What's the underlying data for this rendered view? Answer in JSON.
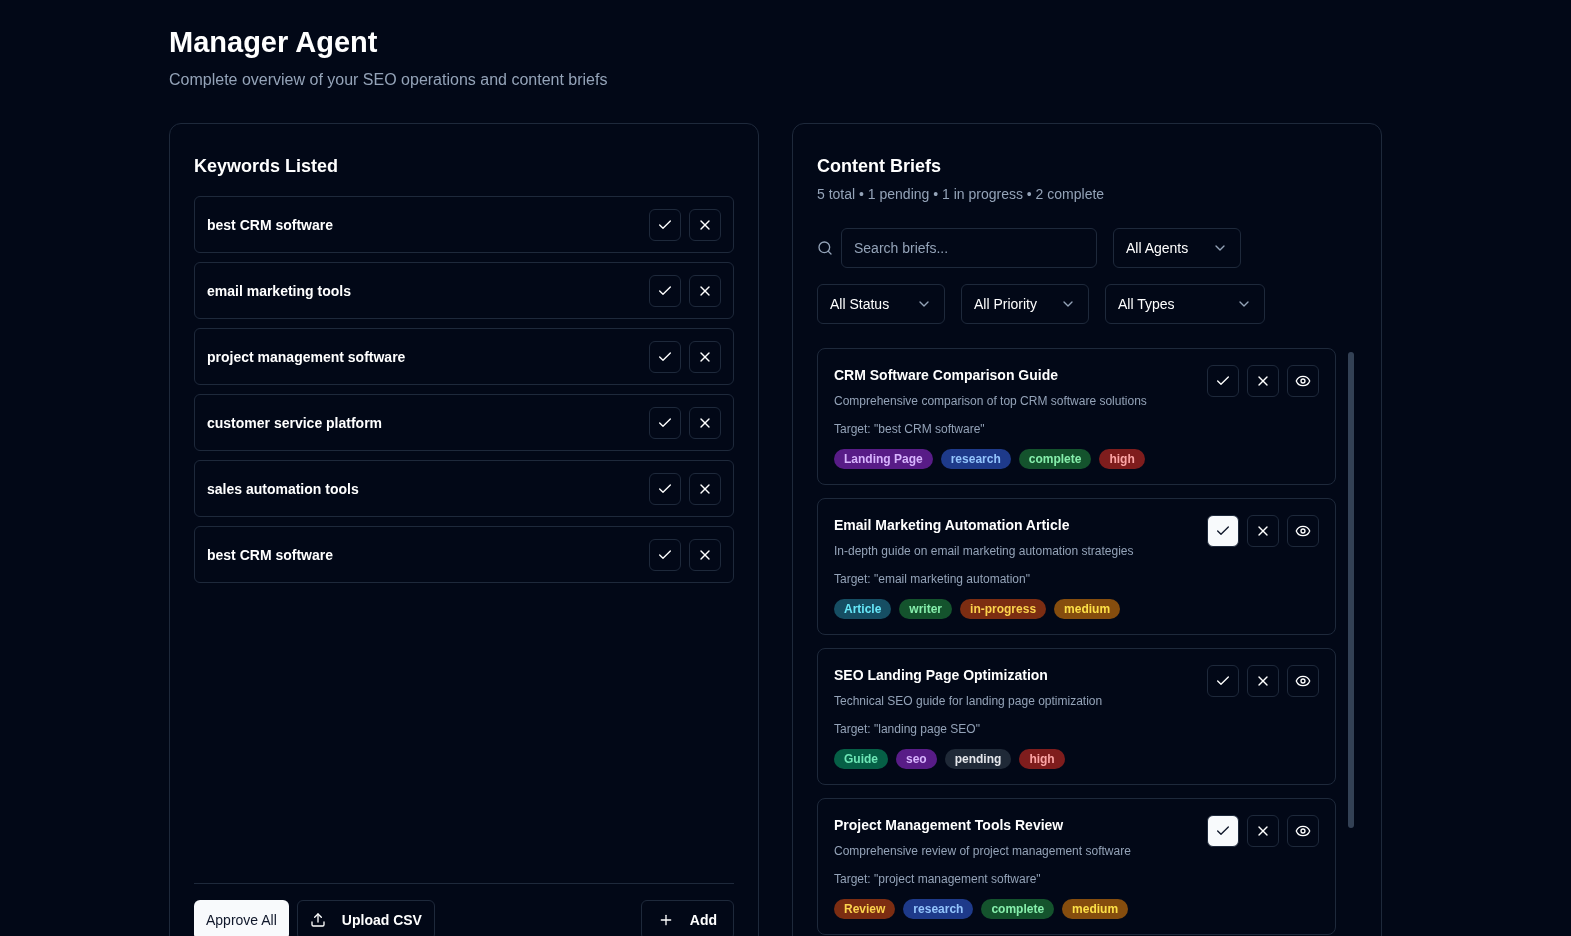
{
  "header": {
    "title": "Manager Agent",
    "subtitle": "Complete overview of your SEO operations and content briefs"
  },
  "keywords": {
    "title": "Keywords Listed",
    "items": [
      {
        "text": "best CRM software"
      },
      {
        "text": "email marketing tools"
      },
      {
        "text": "project management software"
      },
      {
        "text": "customer service platform"
      },
      {
        "text": "sales automation tools"
      },
      {
        "text": "best CRM software"
      }
    ],
    "actions": [
      "Approve All",
      "Upload CSV",
      "Add"
    ]
  },
  "briefs": {
    "title": "Content Briefs",
    "summary": "5 total • 1 pending • 1 in progress • 2 complete",
    "search": {
      "placeholder": "Search briefs..."
    },
    "filters": [
      "All Agents",
      "All Status",
      "All Priority",
      "All Types"
    ],
    "items": [
      {
        "title": "CRM Software Comparison Guide",
        "description": "Comprehensive comparison of top CRM software solutions",
        "target": "Target: \"best CRM software\"",
        "approved": false,
        "tags": [
          {
            "label": "Landing Page",
            "color": "#581c87"
          },
          {
            "label": "research",
            "color": "#1e3a8a"
          },
          {
            "label": "complete",
            "color": "#14532d"
          },
          {
            "label": "high",
            "color": "#7f1d1d"
          }
        ]
      },
      {
        "title": "Email Marketing Automation Article",
        "description": "In-depth guide on email marketing automation strategies",
        "target": "Target: \"email marketing automation\"",
        "approved": true,
        "tags": [
          {
            "label": "Article",
            "color": "#164e63"
          },
          {
            "label": "writer",
            "color": "#14532d"
          },
          {
            "label": "in-progress",
            "color": "#7c2d12"
          },
          {
            "label": "medium",
            "color": "#854d0e"
          }
        ]
      },
      {
        "title": "SEO Landing Page Optimization",
        "description": "Technical SEO guide for landing page optimization",
        "target": "Target: \"landing page SEO\"",
        "approved": false,
        "tags": [
          {
            "label": "Guide",
            "color": "#065f46"
          },
          {
            "label": "seo",
            "color": "#581c87"
          },
          {
            "label": "pending",
            "color": "#1f2937"
          },
          {
            "label": "high",
            "color": "#7f1d1d"
          }
        ]
      },
      {
        "title": "Project Management Tools Review",
        "description": "Comprehensive review of project management software",
        "target": "Target: \"project management software\"",
        "approved": true,
        "tags": [
          {
            "label": "Review",
            "color": "#7c2d12"
          },
          {
            "label": "research",
            "color": "#1e3a8a"
          },
          {
            "label": "complete",
            "color": "#14532d"
          },
          {
            "label": "medium",
            "color": "#854d0e"
          }
        ]
      }
    ]
  }
}
